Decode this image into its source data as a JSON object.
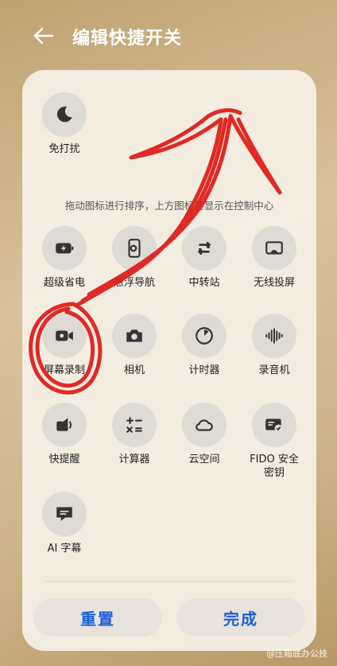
{
  "header": {
    "title": "编辑快捷开关"
  },
  "top_tiles": [
    {
      "label": "免打扰",
      "icon": "moon-icon"
    }
  ],
  "hint": "拖动图标进行排序，上方图标将显示在控制中心",
  "tiles": [
    {
      "label": "超级省电",
      "icon": "battery-saver-icon"
    },
    {
      "label": "悬浮导航",
      "icon": "floating-nav-icon"
    },
    {
      "label": "中转站",
      "icon": "transfer-icon"
    },
    {
      "label": "无线投屏",
      "icon": "cast-icon"
    },
    {
      "label": "屏幕录制",
      "icon": "screen-record-icon"
    },
    {
      "label": "相机",
      "icon": "camera-icon"
    },
    {
      "label": "计时器",
      "icon": "timer-icon"
    },
    {
      "label": "录音机",
      "icon": "recorder-icon"
    },
    {
      "label": "快提醒",
      "icon": "reminder-icon"
    },
    {
      "label": "计算器",
      "icon": "calculator-icon"
    },
    {
      "label": "云空间",
      "icon": "cloud-icon"
    },
    {
      "label": "FIDO 安全\n密钥",
      "icon": "fido-key-icon"
    },
    {
      "label": "AI 字幕",
      "icon": "subtitle-icon"
    }
  ],
  "buttons": {
    "reset": "重置",
    "done": "完成"
  },
  "watermark": "@压箱底办公技",
  "colors": {
    "accent": "#1e5fd6",
    "annotation": "#e0201c"
  }
}
